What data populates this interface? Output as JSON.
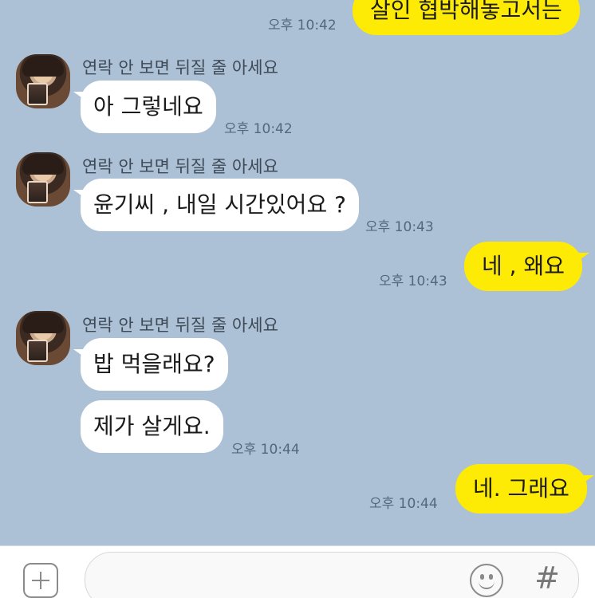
{
  "chat": {
    "contact_name": "연락 안 보면 뒤질 줄 아세요",
    "messages": [
      {
        "direction": "out",
        "text": "살인 협박해놓고서는",
        "time": "오후 10:42"
      },
      {
        "direction": "in",
        "sender": "연락 안 보면 뒤질 줄 아세요",
        "text": "아 그렇네요",
        "time": "오후 10:42"
      },
      {
        "direction": "in",
        "sender": "연락 안 보면 뒤질 줄 아세요",
        "text": "윤기씨 , 내일 시간있어요 ?",
        "time": "오후 10:43"
      },
      {
        "direction": "out",
        "text": "네 , 왜요",
        "time": "오후 10:43"
      },
      {
        "direction": "in",
        "sender": "연락 안 보면 뒤질 줄 아세요",
        "text": "밥 먹을래요?"
      },
      {
        "direction": "in",
        "text": "제가 살게요.",
        "time": "오후 10:44"
      },
      {
        "direction": "out",
        "text": "네. 그래요",
        "time": "오후 10:44"
      }
    ]
  },
  "input_bar": {
    "message_value": "",
    "icons": {
      "attach": "plus-icon",
      "emoji": "emoji-icon",
      "hashtag": "hashtag-icon"
    },
    "hash_glyph": "#"
  },
  "colors": {
    "background": "#acc1d5",
    "incoming_bubble": "#ffffff",
    "outgoing_bubble": "#fdea05"
  }
}
